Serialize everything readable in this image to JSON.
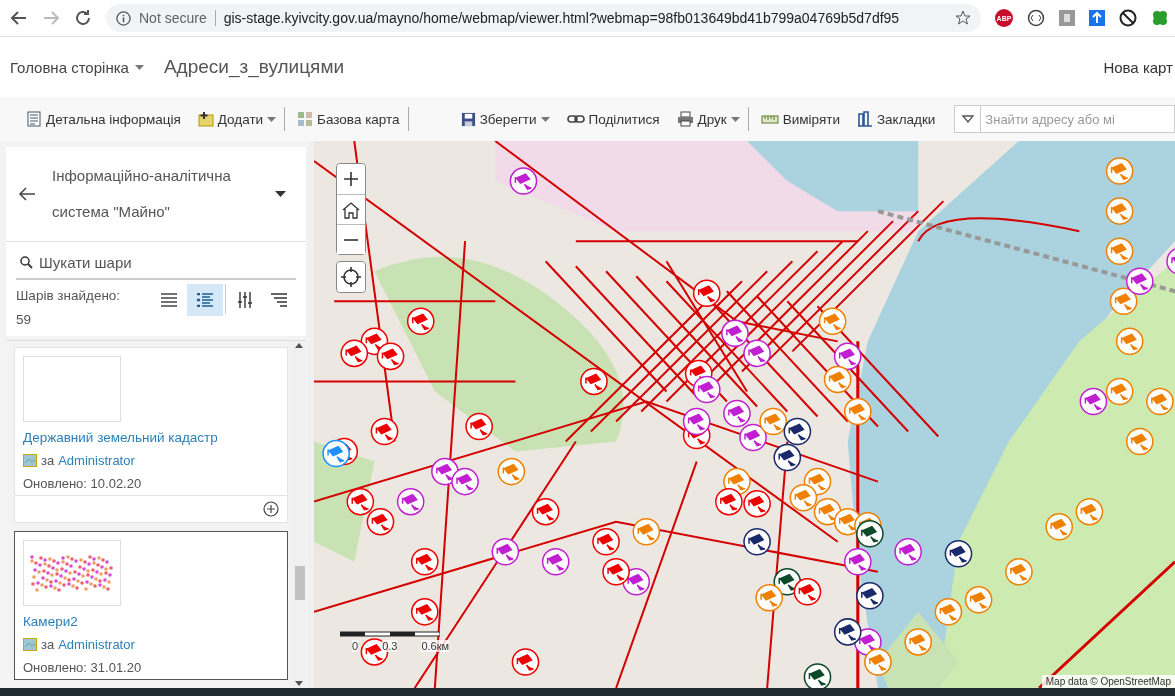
{
  "browser": {
    "security_label": "Not secure",
    "url": "gis-stage.kyivcity.gov.ua/mayno/home/webmap/viewer.html?webmap=98fb013649bd41b799a04769b5d7df95",
    "extension_badge": "ABP"
  },
  "header": {
    "home_menu": "Головна сторінка",
    "map_title": "Адреси_з_вулицями",
    "right_link": "Нова карт"
  },
  "toolbar": {
    "items": [
      {
        "kind": "details",
        "label": "Детальна інформація",
        "dropdown": false,
        "separator_after": false
      },
      {
        "kind": "add",
        "label": "Додати",
        "dropdown": true,
        "separator_after": true
      },
      {
        "kind": "basemap",
        "label": "Базова карта",
        "dropdown": false,
        "separator_after": true
      },
      {
        "kind": "save",
        "label": "Зберегти",
        "dropdown": true,
        "separator_after": false
      },
      {
        "kind": "share",
        "label": "Поділитися",
        "dropdown": false,
        "separator_after": false
      },
      {
        "kind": "print",
        "label": "Друк",
        "dropdown": true,
        "separator_after": true
      },
      {
        "kind": "measure",
        "label": "Виміряти",
        "dropdown": false,
        "separator_after": false
      },
      {
        "kind": "bookmarks",
        "label": "Закладки",
        "dropdown": false,
        "separator_after": false
      }
    ],
    "search": {
      "placeholder": "Знайти адресу або мі"
    }
  },
  "panel": {
    "title": "Інформаційно-аналітична система \"Майно\"",
    "search": {
      "placeholder": "Шукати шари"
    },
    "found_label": "Шарів знайдено:",
    "found_count": "59",
    "views": [
      {
        "kind": "list",
        "selected": false
      },
      {
        "kind": "details",
        "selected": true
      }
    ],
    "cards": [
      {
        "title": "Державний земельний кадастр",
        "by": "за",
        "author": "Administrator",
        "updated": "Оновлено: 10.02.20",
        "kind": "blank",
        "selected": false,
        "add_button": true
      },
      {
        "title": "Камери2",
        "by": "за",
        "author": "Administrator",
        "updated": "Оновлено: 31.01.20",
        "kind": "points",
        "selected": true,
        "add_button": false
      }
    ]
  },
  "map": {
    "scale_labels": [
      "0",
      "0.3",
      "0.6км"
    ],
    "attribution": "Map data © OpenStreetMap"
  }
}
